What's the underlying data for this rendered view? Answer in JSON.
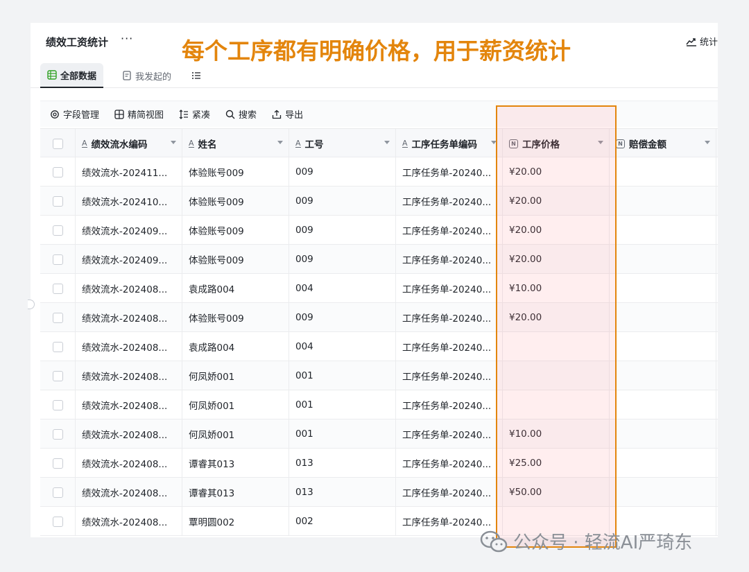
{
  "app": {
    "title": "绩效工资统计",
    "more_glyph": "···",
    "stats_label": "统计"
  },
  "tabs": [
    {
      "label": "全部数据",
      "active": true
    },
    {
      "label": "我发起的",
      "active": false
    }
  ],
  "banner": "每个工序都有明确价格，用于薪资统计",
  "toolbar": {
    "field_manage": "字段管理",
    "simple_view": "精简视图",
    "compact": "紧凑",
    "search": "搜索",
    "export": "导出"
  },
  "table": {
    "columns": [
      {
        "label": "绩效流水编码",
        "type": "text"
      },
      {
        "label": "姓名",
        "type": "text"
      },
      {
        "label": "工号",
        "type": "text"
      },
      {
        "label": "工序任务单编码",
        "type": "text"
      },
      {
        "label": "工序价格",
        "type": "number"
      },
      {
        "label": "赔偿金额",
        "type": "number"
      }
    ],
    "rows": [
      [
        "绩效流水-202411...",
        "体验账号009",
        "009",
        "工序任务单-20240...",
        "¥20.00",
        ""
      ],
      [
        "绩效流水-202410...",
        "体验账号009",
        "009",
        "工序任务单-20240...",
        "¥20.00",
        ""
      ],
      [
        "绩效流水-202409...",
        "体验账号009",
        "009",
        "工序任务单-20240...",
        "¥20.00",
        ""
      ],
      [
        "绩效流水-202409...",
        "体验账号009",
        "009",
        "工序任务单-20240...",
        "¥20.00",
        ""
      ],
      [
        "绩效流水-202408...",
        "袁成路004",
        "004",
        "工序任务单-20240...",
        "¥10.00",
        ""
      ],
      [
        "绩效流水-202408...",
        "体验账号009",
        "009",
        "工序任务单-20240...",
        "¥20.00",
        ""
      ],
      [
        "绩效流水-202408...",
        "袁成路004",
        "004",
        "工序任务单-20240...",
        "",
        ""
      ],
      [
        "绩效流水-202408...",
        "何凤娇001",
        "001",
        "工序任务单-20240...",
        "",
        ""
      ],
      [
        "绩效流水-202408...",
        "何凤娇001",
        "001",
        "工序任务单-20240...",
        "",
        ""
      ],
      [
        "绩效流水-202408...",
        "何凤娇001",
        "001",
        "工序任务单-20240...",
        "¥10.00",
        ""
      ],
      [
        "绩效流水-202408...",
        "谭睿其013",
        "013",
        "工序任务单-20240...",
        "¥25.00",
        ""
      ],
      [
        "绩效流水-202408...",
        "谭睿其013",
        "013",
        "工序任务单-20240...",
        "¥50.00",
        ""
      ],
      [
        "绩效流水-202408...",
        "覃明圆002",
        "002",
        "工序任务单-20240...",
        "",
        ""
      ]
    ]
  },
  "watermark": "公众号 · 轻流AI严琦东",
  "colors": {
    "accent_orange": "#e3850c",
    "highlight_fill": "#ffd8dc"
  }
}
